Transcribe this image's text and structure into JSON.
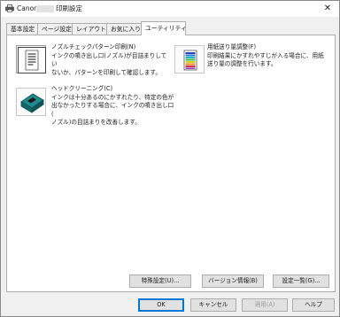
{
  "window": {
    "title_prefix": "Canon",
    "title_suffix": "印刷設定",
    "close_label": "✕"
  },
  "tabs": [
    {
      "label": "基本設定"
    },
    {
      "label": "ページ設定"
    },
    {
      "label": "レイアウト"
    },
    {
      "label": "お気に入り"
    },
    {
      "label": "ユーティリティ"
    }
  ],
  "tools": {
    "nozzle_check": {
      "title": "ノズルチェックパターン印刷(N)",
      "desc_1": "インクの噴き出し口(ノズル)が目詰まりしてい",
      "desc_2": "ないか、パターンを印刷して確認します。"
    },
    "paper_feed": {
      "title": "用紙送り量調整(F)",
      "desc_1": "印刷結果にかすれやすじが入る場合に、用紙",
      "desc_2": "送り量の調整を行います。"
    },
    "head_cleaning": {
      "title": "ヘッドクリーニング(C)",
      "desc_1": "インクは十分あるのにかすれたり、特定の色が",
      "desc_2": "出なかったりする場合に、インクの噴き出し口(",
      "desc_3": "ノズル)の目詰まりを改善します。"
    }
  },
  "panel_buttons": {
    "special_settings": "特殊設定(U)...",
    "version_info": "バージョン情報(B)",
    "settings_list": "設定一覧(G)..."
  },
  "dialog_buttons": {
    "ok": "OK",
    "cancel": "キャンセル",
    "apply": "適用(A)",
    "help": "ヘルプ"
  }
}
